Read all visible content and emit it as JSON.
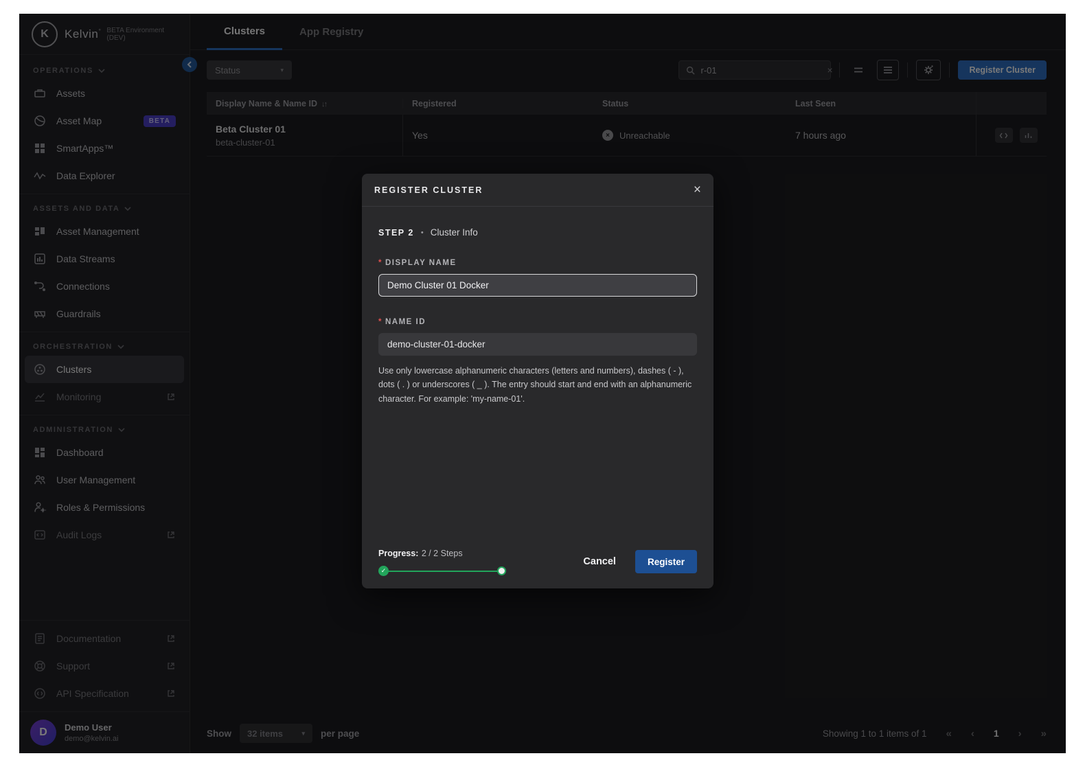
{
  "brand": {
    "logo_letter": "K",
    "name": "Kelvin",
    "mark": "°",
    "environment": "BETA Environment (DEV)"
  },
  "sidebar": {
    "sections": [
      {
        "title": "OPERATIONS",
        "items": [
          {
            "label": "Assets"
          },
          {
            "label": "Asset Map",
            "badge": "BETA"
          },
          {
            "label": "SmartApps™"
          },
          {
            "label": "Data Explorer"
          }
        ]
      },
      {
        "title": "ASSETS AND DATA",
        "items": [
          {
            "label": "Asset Management"
          },
          {
            "label": "Data Streams"
          },
          {
            "label": "Connections"
          },
          {
            "label": "Guardrails"
          }
        ]
      },
      {
        "title": "ORCHESTRATION",
        "items": [
          {
            "label": "Clusters"
          },
          {
            "label": "Monitoring"
          }
        ]
      },
      {
        "title": "ADMINISTRATION",
        "items": [
          {
            "label": "Dashboard"
          },
          {
            "label": "User Management"
          },
          {
            "label": "Roles & Permissions"
          },
          {
            "label": "Audit Logs"
          }
        ]
      }
    ],
    "footer_items": [
      {
        "label": "Documentation"
      },
      {
        "label": "Support"
      },
      {
        "label": "API Specification"
      }
    ],
    "user": {
      "initial": "D",
      "name": "Demo User",
      "email": "demo@kelvin.ai"
    }
  },
  "header": {
    "tabs": [
      {
        "label": "Clusters"
      },
      {
        "label": "App Registry"
      }
    ]
  },
  "toolbar": {
    "status_label": "Status",
    "search_value": "r-01",
    "clear_glyph": "×",
    "register_label": "Register Cluster"
  },
  "table": {
    "columns": {
      "name": "Display Name & Name ID",
      "registered": "Registered",
      "status": "Status",
      "last_seen": "Last Seen"
    },
    "sort_icon": "↓↑",
    "rows": [
      {
        "display_name": "Beta Cluster 01",
        "name_id": "beta-cluster-01",
        "registered": "Yes",
        "status": "Unreachable",
        "status_glyph": "×",
        "last_seen": "7 hours ago"
      }
    ]
  },
  "pagination": {
    "show_label": "Show",
    "page_size": "32 items",
    "per_page_label": "per page",
    "summary": "Showing 1 to 1 items of 1",
    "first": "«",
    "prev": "‹",
    "page": "1",
    "next": "›",
    "last": "»"
  },
  "modal": {
    "title": "REGISTER CLUSTER",
    "close_glyph": "×",
    "step_label": "STEP 2",
    "step_separator": "•",
    "step_name": "Cluster Info",
    "required_marker": "*",
    "display_name": {
      "label": "DISPLAY NAME",
      "value": "Demo Cluster 01 Docker"
    },
    "name_id": {
      "label": "NAME ID",
      "value": "demo-cluster-01-docker",
      "help": "Use only lowercase alphanumeric characters (letters and numbers), dashes ( - ), dots ( . ) or underscores ( _ ). The entry should start and end with an alphanumeric character. For example: 'my-name-01'."
    },
    "progress": {
      "label": "Progress:",
      "value": "2 / 2 Steps",
      "check_glyph": "✓"
    },
    "cancel_label": "Cancel",
    "register_label": "Register"
  },
  "colors": {
    "accent_blue": "#2f6fc2",
    "modal_register_blue": "#1d4f93",
    "progress_green": "#22a55b",
    "beta_purple": "#4b3fc9",
    "required_red": "#e0504f"
  }
}
